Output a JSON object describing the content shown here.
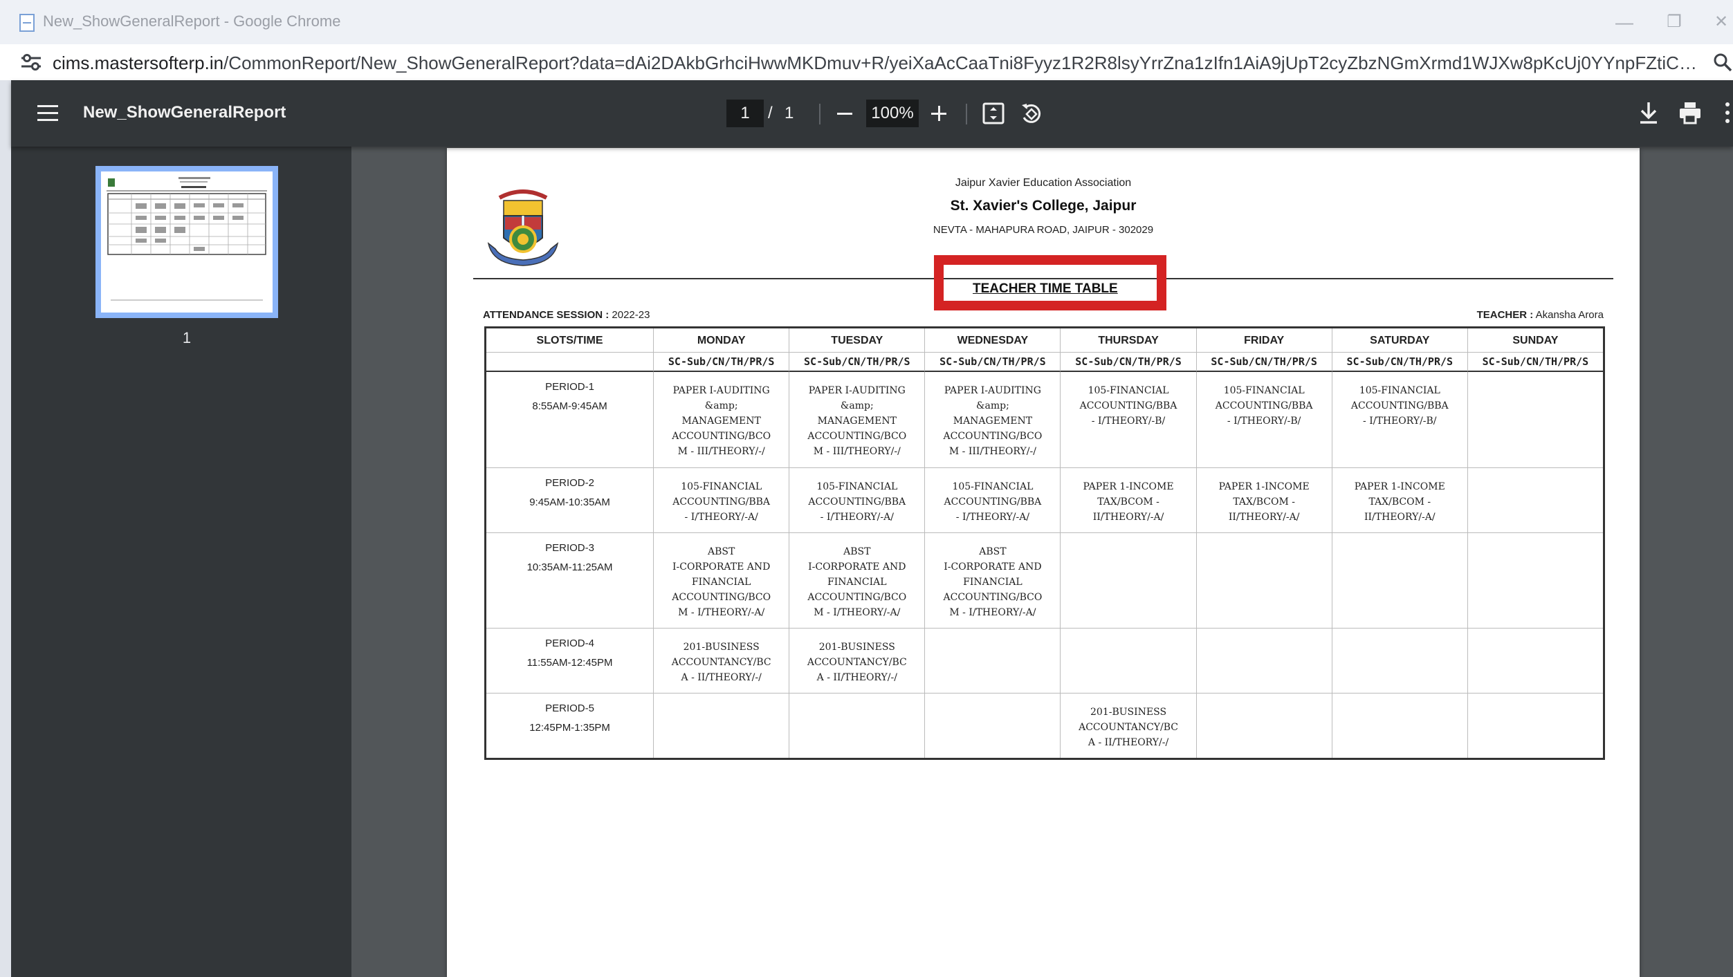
{
  "window": {
    "title": "New_ShowGeneralReport - Google Chrome",
    "controls": {
      "minimize": "—",
      "restore": "❐",
      "close": "✕"
    }
  },
  "address_bar": {
    "url_host": "cims.mastersofterp.in",
    "url_rest": "/CommonReport/New_ShowGeneralReport?data=dAi2DAkbGrhciHwwMKDmuv+R/yeiXaAcCaaTni8Fyyz1R2R8lsyYrrZna1zIfn1AiA9jUpT2cyZbzNGmXrmd1WJXw8pKcUj0YYnpFZtiCs/PjVgBODntkfUS/6/5Ry8keZzjvuoY..."
  },
  "pdf_toolbar": {
    "doc_title": "New_ShowGeneralReport",
    "page_current": "1",
    "page_separator": "/",
    "page_total": "1",
    "zoom": "100%"
  },
  "sidebar": {
    "thumbnails": [
      {
        "page_label": "1"
      }
    ]
  },
  "report": {
    "association": "Jaipur Xavier Education Association",
    "college": "St. Xavier's College, Jaipur",
    "address": "NEVTA - MAHAPURA ROAD, JAIPUR - 302029",
    "title": "TEACHER TIME TABLE",
    "session_label": "ATTENDANCE SESSION :",
    "session_value": "2022-23",
    "teacher_label": "TEACHER :",
    "teacher_value": "Akansha  Arora",
    "highlight_color": "#d42323",
    "columns": [
      "SLOTS/TIME",
      "MONDAY",
      "TUESDAY",
      "WEDNESDAY",
      "THURSDAY",
      "FRIDAY",
      "SATURDAY",
      "SUNDAY"
    ],
    "subheader": "SC-Sub/CN/TH/PR/S",
    "rows": [
      {
        "period": "PERIOD-1",
        "time": "8:55AM-9:45AM",
        "cells": [
          "PAPER I-AUDITING\n&amp;\nMANAGEMENT\nACCOUNTING/BCO\nM - III/THEORY/-/",
          "PAPER I-AUDITING\n&amp;\nMANAGEMENT\nACCOUNTING/BCO\nM - III/THEORY/-/",
          "PAPER I-AUDITING\n&amp;\nMANAGEMENT\nACCOUNTING/BCO\nM - III/THEORY/-/",
          "105-FINANCIAL\nACCOUNTING/BBA\n- I/THEORY/-B/",
          "105-FINANCIAL\nACCOUNTING/BBA\n- I/THEORY/-B/",
          "105-FINANCIAL\nACCOUNTING/BBA\n- I/THEORY/-B/",
          ""
        ]
      },
      {
        "period": "PERIOD-2",
        "time": "9:45AM-10:35AM",
        "cells": [
          "105-FINANCIAL\nACCOUNTING/BBA\n- I/THEORY/-A/",
          "105-FINANCIAL\nACCOUNTING/BBA\n- I/THEORY/-A/",
          "105-FINANCIAL\nACCOUNTING/BBA\n- I/THEORY/-A/",
          "PAPER 1-INCOME\nTAX/BCOM -\nII/THEORY/-A/",
          "PAPER 1-INCOME\nTAX/BCOM -\nII/THEORY/-A/",
          "PAPER 1-INCOME\nTAX/BCOM -\nII/THEORY/-A/",
          ""
        ]
      },
      {
        "period": "PERIOD-3",
        "time": "10:35AM-11:25AM",
        "cells": [
          "ABST\nI-CORPORATE AND\nFINANCIAL\nACCOUNTING/BCO\nM - I/THEORY/-A/",
          "ABST\nI-CORPORATE AND\nFINANCIAL\nACCOUNTING/BCO\nM - I/THEORY/-A/",
          "ABST\nI-CORPORATE AND\nFINANCIAL\nACCOUNTING/BCO\nM - I/THEORY/-A/",
          "",
          "",
          "",
          ""
        ]
      },
      {
        "period": "PERIOD-4",
        "time": "11:55AM-12:45PM",
        "cells": [
          "201-BUSINESS\nACCOUNTANCY/BC\nA - II/THEORY/-/",
          "201-BUSINESS\nACCOUNTANCY/BC\nA - II/THEORY/-/",
          "",
          "",
          "",
          "",
          ""
        ]
      },
      {
        "period": "PERIOD-5",
        "time": "12:45PM-1:35PM",
        "cells": [
          "",
          "",
          "",
          "201-BUSINESS\nACCOUNTANCY/BC\nA - II/THEORY/-/",
          "",
          "",
          ""
        ]
      }
    ]
  }
}
